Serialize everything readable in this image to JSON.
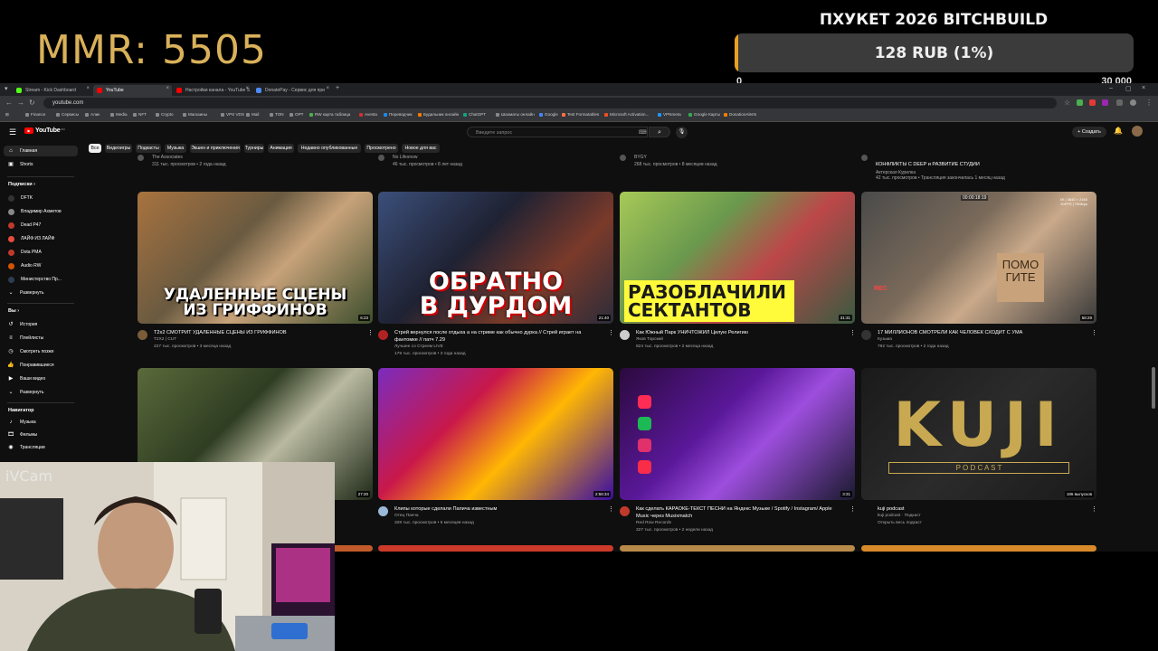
{
  "overlay": {
    "mmr": "MMR: 5505",
    "goal_title": "ПХУКЕТ 2026 BITCHBUILD",
    "goal_text": "128 RUB (1%)",
    "goal_progress_percent": 1,
    "goal_sub_left": "0",
    "goal_sub_right": "30 000",
    "webcam_label": "iVCam",
    "accent": "#d9b15a",
    "progress_color": "#e8a020"
  },
  "browser": {
    "tabs": [
      {
        "label": "Stream - Kick Dashboard",
        "color": "#53fc18"
      },
      {
        "label": "YouTube",
        "color": "#ff0000"
      },
      {
        "label": "Настройки канала - YouTube S",
        "color": "#ff0000"
      },
      {
        "label": "DonatePay - Сервис для при",
        "color": "#4c8bf5"
      }
    ],
    "url": "youtube.com",
    "bookmarks": [
      "Finance",
      "Сервисы",
      "Алик",
      "Media",
      "NFT",
      "Crypto",
      "Магазины",
      "VPS VDS",
      "Mail",
      "TON",
      "OPT",
      "RW карта таблица",
      "Avesta",
      "Переводчик",
      "Будильник онлайн",
      "ChatGPT",
      "Шахматы онлайн",
      "Google",
      "Test Formatables",
      "Microsoft Activation...",
      "VPNmeta",
      "Google Карты",
      "DonationAlerts"
    ]
  },
  "youtube": {
    "logo": "YouTube",
    "logo_cc": "RU",
    "search_placeholder": "Введите запрос",
    "create_label": "+ Создать",
    "sidebar": {
      "main": [
        {
          "label": "Главная",
          "icon": "home-icon",
          "active": true
        },
        {
          "label": "Shorts",
          "icon": "shorts-icon",
          "active": false
        }
      ],
      "subs_header": "Подписки  ›",
      "subs": [
        {
          "label": "DFTK",
          "color": "#333333"
        },
        {
          "label": "Владимир Ахметов",
          "color": "#888888"
        },
        {
          "label": "Dead P47",
          "color": "#c0392b"
        },
        {
          "label": "ЛАЙФ ИЗ ЛАЙФ",
          "color": "#e74c3c"
        },
        {
          "label": "Dota PMA",
          "color": "#c0392b"
        },
        {
          "label": "Audio RW",
          "color": "#d35400"
        },
        {
          "label": "Министерство Пр...",
          "color": "#2c3e50"
        },
        {
          "label": "Развернуть",
          "color": ""
        }
      ],
      "you_header": "Вы  ›",
      "you": [
        {
          "label": "История",
          "icon": "history-icon"
        },
        {
          "label": "Плейлисты",
          "icon": "playlist-icon"
        },
        {
          "label": "Смотреть позже",
          "icon": "clock-icon"
        },
        {
          "label": "Понравившиеся",
          "icon": "like-icon"
        },
        {
          "label": "Ваши видео",
          "icon": "video-icon"
        },
        {
          "label": "Развернуть",
          "icon": "chevron-down-icon"
        }
      ],
      "nav_header": "Навигатор",
      "nav": [
        {
          "label": "Музыка",
          "icon": "music-icon"
        },
        {
          "label": "Фильмы",
          "icon": "film-icon"
        },
        {
          "label": "Трансляции",
          "icon": "live-icon"
        }
      ]
    },
    "chips": [
      "Все",
      "Видеоигры",
      "Подкасты",
      "Музыка",
      "Экшен и приключения",
      "Турниры",
      "Анимация",
      "Недавно опубликованные",
      "Просмотрено",
      "Новое для вас"
    ],
    "prev_row": [
      {
        "channel": "The Associates",
        "meta": "311 тыс. просмотров • 2 года назад"
      },
      {
        "channel": "No Lifesnow",
        "meta": "46 тыс. просмотров • 8 лет назад"
      },
      {
        "channel": "BYGY",
        "meta": "268 тыс. просмотров • 8 месяцев назад"
      },
      {
        "title": "КОНФЛИКТЫ С DEEP и РАЗВИТИЕ СТУДИИ",
        "channel": "Актерская Курилка",
        "meta": "42 тыс. просмотров • Трансляция закончилась 1 месяц назад"
      }
    ],
    "videos": [
      {
        "title": "T2x2 СМОТРИТ УДАЛЕННЫЕ СЦЕНЫ ИЗ ГРИФФИНОВ",
        "title2": "",
        "channel": "T2X2 | CUT",
        "meta": "227 тыс. просмотров • 3 месяца назад",
        "duration": "6:23",
        "caption": "УДАЛЕННЫЕ СЦЕНЫ\nИЗ ГРИФФИНОВ",
        "avatar_color": "#7a5c3a"
      },
      {
        "title": "Стрей вернулся после отдыха а на стриме как обычно дурка // Стрей играет на",
        "title2": "фантомке // патч 7.29",
        "channel": "Лучшее со Стреем LIVE",
        "meta": "179 тыс. просмотров • 3 года назад",
        "duration": "21:40",
        "caption": "ОБРАТНО\nВ ДУРДОМ",
        "avatar_color": "#b22222"
      },
      {
        "title": "Как Южный Парк УНИЧТОЖИЛ Целую Религию",
        "title2": "",
        "channel": "Яков Торский",
        "meta": "824 тыс. просмотров • 2 месяца назад",
        "duration": "31:31",
        "caption": "РАЗОБЛАЧИЛИ\nСЕКТАНТОВ",
        "avatar_color": "#cccccc"
      },
      {
        "title": "17 МИЛЛИОНОВ СМОТРЕЛИ КАК ЧЕЛОВЕК СХОДИТ С УМА",
        "title2": "",
        "channel": "Кузьма",
        "meta": "792 тыс. просмотров • 2 года назад",
        "duration": "58:29",
        "caption": "",
        "avatar_color": "#333333",
        "rec": "REC",
        "timer": "00:00:18:19",
        "tag": "4K | 3840 × 2160\n30FPS | 70Mbps",
        "sign": "ПОМО\nГИТЕ"
      },
      {
        "title": "",
        "title2": "",
        "channel": "",
        "meta": "",
        "duration": "27:20",
        "caption": "",
        "avatar_color": "#555555"
      },
      {
        "title": "Клипы которые сделали Папича известным",
        "title2": "",
        "channel": "Отец Панча",
        "meta": "328 тыс. просмотров • 5 месяцев назад",
        "duration": "2:56:34",
        "caption": "",
        "avatar_color": "#9ab8d8"
      },
      {
        "title": "Как сделать КАРАОКЕ-ТЕКСТ ПЕСНИ на Яндекс Музыке / Spotify / Instagram/ Apple",
        "title2": "Music через Musixmatch",
        "channel": "Red Row Records",
        "meta": "327 тыс. просмотров • 2 недели назад",
        "duration": "3:31",
        "caption": "",
        "avatar_color": "#c0392b"
      },
      {
        "title": "kuji podcast",
        "title2": "",
        "channel": "kuji podcast · Подкаст",
        "meta": "Открыть весь подкаст",
        "duration": "186 выпусков",
        "caption": "",
        "avatar_color": "",
        "logo_big": "KUJI",
        "logo_small": "P O D C A S T"
      }
    ]
  }
}
